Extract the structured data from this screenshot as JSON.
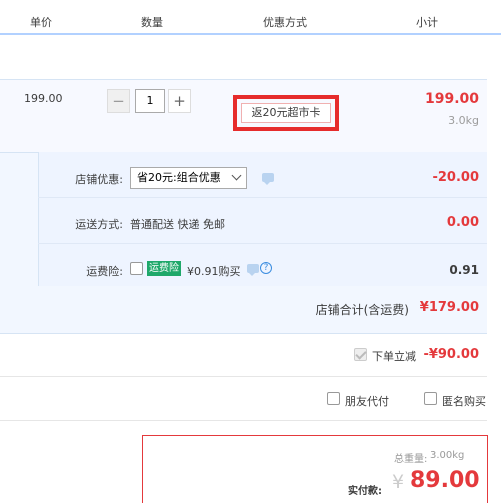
{
  "header": {
    "col_price": "单价",
    "col_qty": "数量",
    "col_promo": "优惠方式",
    "col_subtotal": "小计"
  },
  "item": {
    "price": "199.00",
    "qty_minus": "−",
    "quantity": "1",
    "qty_plus": "+",
    "promo_tag": "返20元超市卡",
    "subtotal": "199.00",
    "weight": "3.0kg"
  },
  "shop": {
    "discount_label": "店铺优惠:",
    "discount_select": "省20元:组合优惠",
    "discount_value": "-20.00",
    "shipping_label": "运送方式:",
    "shipping_value": "普通配送 快递 免邮",
    "shipping_fee": "0.00",
    "insurance_label": "运费险:",
    "insurance_badge": "运费险",
    "insurance_text": "¥0.91购买",
    "insurance_value": "0.91",
    "help_glyph": "?",
    "total_label": "店铺合计(含运费)",
    "total_value": "¥179.00"
  },
  "instant_discount": {
    "label": "下单立减",
    "value": "-¥90.00"
  },
  "options": {
    "friend_pay": "朋友代付",
    "anonymous": "匿名购买"
  },
  "summary": {
    "weight_label": "总重量:",
    "weight_value": "3.00kg",
    "pay_label": "实付款:",
    "currency": "¥",
    "pay_value": "89.00"
  },
  "colors": {
    "accent_red": "#e4393c",
    "highlight_border": "#e62c2c",
    "insurance_green": "#1fa86a",
    "row_bg": "#f2f7ff"
  }
}
